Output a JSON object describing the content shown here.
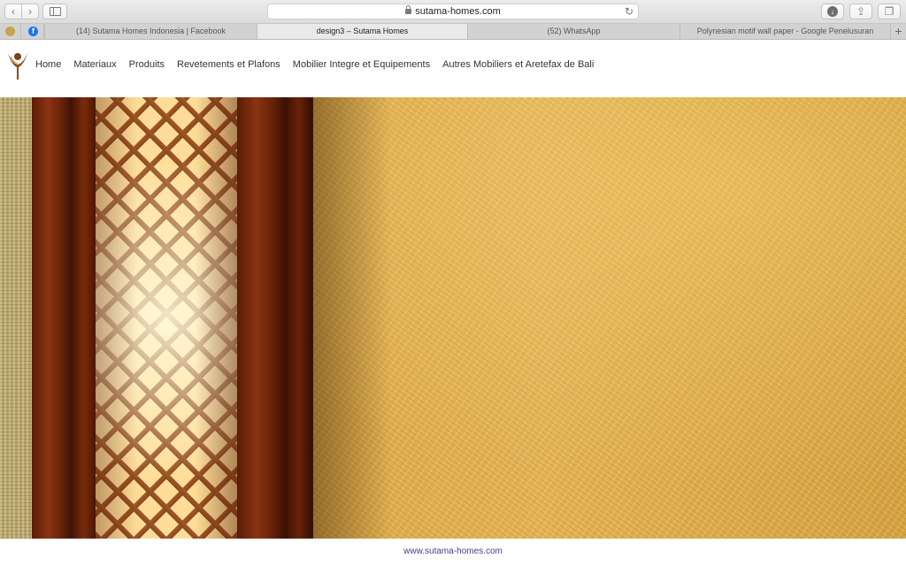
{
  "browser": {
    "url": "sutama-homes.com",
    "icons": {
      "back": "chevron-left-icon",
      "forward": "chevron-right-icon",
      "sidebar": "sidebar-icon",
      "reload": "reload-icon",
      "download": "download-icon",
      "share": "share-icon",
      "tabs": "tabs-icon",
      "new_tab": "plus-icon"
    },
    "tabs": [
      {
        "label": "(14) Sutama Homes Indonesia | Facebook",
        "active": false
      },
      {
        "label": "design3 – Sutama Homes",
        "active": true
      },
      {
        "label": "(52) WhatsApp",
        "active": false
      },
      {
        "label": "Polynesian motif wall paper - Google Penelusuran",
        "active": false
      }
    ]
  },
  "site": {
    "menu": [
      "Home",
      "Materiaux",
      "Produits",
      "Revetements et Plafons",
      "Mobilier Integre et Equipements",
      "Autres Mobiliers et Aretefax de Bali"
    ],
    "footer_link": "www.sutama-homes.com",
    "colors": {
      "footer_link": "#4b3a8f",
      "wood": "#6b240a",
      "mat": "#d7a245"
    }
  }
}
